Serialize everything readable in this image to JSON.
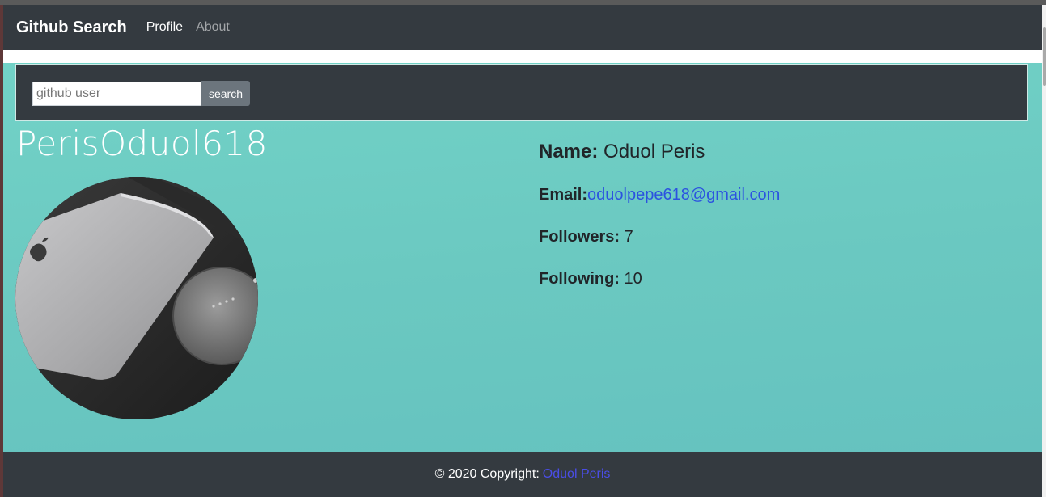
{
  "navbar": {
    "brand": "Github Search",
    "links": [
      "Profile",
      "About"
    ]
  },
  "search": {
    "placeholder": "github user",
    "value": "",
    "button_label": "search"
  },
  "profile": {
    "username": "PerisOduol618",
    "name_label": "Name:",
    "name": "Oduol Peris",
    "email_label": "Email:",
    "email": "oduolpepe618@gmail.com",
    "followers_label": "Followers:",
    "followers": "7",
    "following_label": "Following:",
    "following": "10"
  },
  "footer": {
    "copyright": "© 2020 Copyright:",
    "author": "Oduol Peris"
  },
  "colors": {
    "navbar_bg": "#343a40",
    "main_bg": "#6bc9c1",
    "link_blue": "#2b52e0",
    "button_bg": "#6c757d"
  }
}
